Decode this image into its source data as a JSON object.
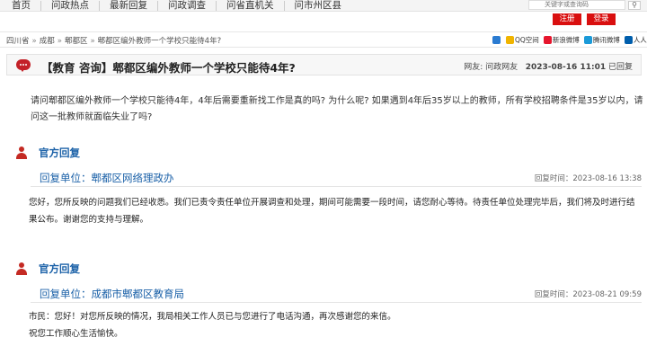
{
  "topnav": {
    "items": [
      "首页",
      "问政热点",
      "最新回复",
      "问政调查",
      "问省直机关",
      "问市州区县"
    ],
    "search_placeholder": "关键字或查询码",
    "search_icon": "search-icon"
  },
  "auth": {
    "register": "注册",
    "login": "登录"
  },
  "breadcrumb": [
    "四川省",
    "成都",
    "郫都区",
    "郫都区编外教师一个学校只能待4年?"
  ],
  "breadcrumb_sep": "»",
  "share": [
    {
      "label": "",
      "icon": "plus-share-icon",
      "color": "#2b7bd1"
    },
    {
      "label": "QQ空间",
      "icon": "qzone-icon",
      "color": "#f0b400"
    },
    {
      "label": "新浪微博",
      "icon": "weibo-icon",
      "color": "#e6162d"
    },
    {
      "label": "腾讯微博",
      "icon": "tencent-weibo-icon",
      "color": "#1b9ad8"
    },
    {
      "label": "人人网",
      "icon": "renren-icon",
      "color": "#005eac"
    }
  ],
  "question": {
    "title": "【教育 咨询】郫都区编外教师一个学校只能待4年?",
    "meta_prefix": "网友:",
    "user": "问政网友",
    "date": "2023-08-16 11:01",
    "status": "已回复",
    "body": "请问郫都区编外教师一个学校只能待4年，4年后需要重新找工作是真的吗? 为什么呢? 如果遇到4年后35岁以上的教师，所有学校招聘条件是35岁以内，请问这一批教师就面临失业了吗?"
  },
  "replies": [
    {
      "section_title": "官方回复",
      "unit_label": "回复单位：郫都区网络理政办",
      "time": "回复时间：2023-08-16 13:38",
      "body": "您好，您所反映的问题我们已经收悉。我们已责令责任单位开展调查和处理，期间可能需要一段时间，请您耐心等待。待责任单位处理完毕后，我们将及时进行结果公布。谢谢您的支持与理解。"
    },
    {
      "section_title": "官方回复",
      "unit_label": "回复单位：成都市郫都区教育局",
      "time": "回复时间：2023-08-21 09:59",
      "body_lines": [
        "市民：您好！对您所反映的情况，我局相关工作人员已与您进行了电话沟通，再次感谢您的来信。",
        "祝您工作顺心生活愉快。"
      ]
    }
  ],
  "colors": {
    "accent_blue": "#1b61a8",
    "accent_red": "#d90f0f"
  }
}
